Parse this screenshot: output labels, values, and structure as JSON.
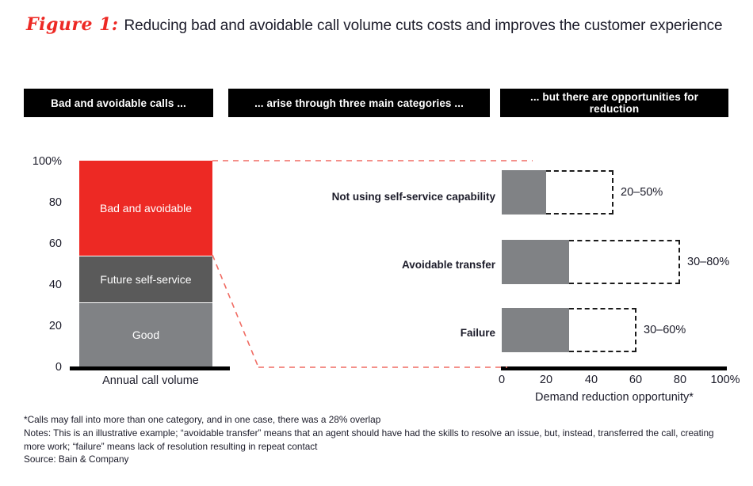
{
  "title": {
    "figure_label": "Figure 1:",
    "text": "Reducing bad and avoidable call volume cuts costs and improves the customer experience"
  },
  "headers": [
    {
      "label": "Bad and avoidable calls ..."
    },
    {
      "label": "... arise through three main categories ..."
    },
    {
      "label": "... but there are opportunities for reduction"
    }
  ],
  "colors": {
    "accent_red": "#ED2924",
    "dark_gray": "#5A5A5A",
    "light_gray": "#808285",
    "axis_black": "#000000",
    "text": "#1b1b29"
  },
  "footnotes": {
    "asterisk": "*Calls may fall into more than one category, and in one case, there was a 28% overlap",
    "notes": "Notes: This is an illustrative example; “avoidable transfer” means that an agent should have had the skills to resolve an issue, but, instead, transferred the call, creating more work; “failure” means lack of resolution resulting in repeat contact",
    "source": "Source: Bain & Company"
  },
  "chart_data": [
    {
      "type": "bar",
      "id": "stacked-call-volume",
      "orientation": "vertical",
      "stacked": true,
      "title": "Annual call volume",
      "xlabel": "Annual call volume",
      "ylabel": "",
      "ylim": [
        0,
        100
      ],
      "yticks": [
        "0",
        "20",
        "40",
        "60",
        "80",
        "100%"
      ],
      "ytick_values": [
        0,
        20,
        40,
        60,
        80,
        100
      ],
      "grid": false,
      "categories": [
        "Annual call volume"
      ],
      "series": [
        {
          "name": "Good",
          "values": [
            31
          ],
          "color": "#808285",
          "label": "Good"
        },
        {
          "name": "Future self-service",
          "values": [
            23
          ],
          "color": "#5A5A5A",
          "label": "Future self-service"
        },
        {
          "name": "Bad and avoidable",
          "values": [
            46
          ],
          "color": "#ED2924",
          "label": "Bad and avoidable"
        }
      ]
    },
    {
      "type": "bar",
      "id": "demand-reduction-opportunity",
      "orientation": "horizontal",
      "title": "Demand reduction opportunity*",
      "xlabel": "Demand reduction opportunity*",
      "ylabel": "",
      "xlim": [
        0,
        100
      ],
      "xticks": [
        "0",
        "20",
        "40",
        "60",
        "80",
        "100%"
      ],
      "xtick_values": [
        0,
        20,
        40,
        60,
        80,
        100
      ],
      "grid": false,
      "categories": [
        "Not using self-service capability",
        "Avoidable transfer",
        "Failure"
      ],
      "ranges": [
        {
          "category": "Not using self-service capability",
          "low": 20,
          "high": 50,
          "label": "20–50%"
        },
        {
          "category": "Avoidable transfer",
          "low": 30,
          "high": 80,
          "label": "30–80%"
        },
        {
          "category": "Failure",
          "low": 30,
          "high": 60,
          "label": "30–60%"
        }
      ]
    }
  ]
}
